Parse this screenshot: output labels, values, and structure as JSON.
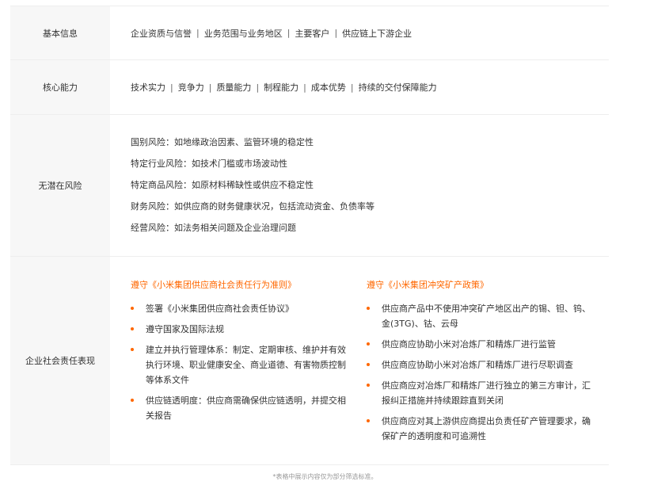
{
  "rows": [
    {
      "label": "基本信息",
      "items": [
        "企业资质与信誉",
        "业务范围与业务地区",
        "主要客户",
        "供应链上下游企业"
      ]
    },
    {
      "label": "核心能力",
      "items": [
        "技术实力",
        "竞争力",
        "质量能力",
        "制程能力",
        "成本优势",
        "持续的交付保障能力"
      ]
    },
    {
      "label": "无潜在风险",
      "lines": [
        "国别风险：如地缘政治因素、监管环境的稳定性",
        "特定行业风险：如技术门槛或市场波动性",
        "特定商品风险：如原材料稀缺性或供应不稳定性",
        "财务风险：如供应商的财务健康状况，包括流动资金、负债率等",
        "经营风险：如法务相关问题及企业治理问题"
      ]
    },
    {
      "label": "企业社会责任表现",
      "columns": [
        {
          "title": "遵守《小米集团供应商社会责任行为准则》",
          "bullets": [
            "签署《小米集团供应商社会责任协议》",
            "遵守国家及国际法规",
            "建立并执行管理体系：制定、定期审核、维护并有效执行环境、职业健康安全、商业道德、有害物质控制等体系文件",
            "供应链透明度：供应商需确保供应链透明，并提交相关报告"
          ]
        },
        {
          "title": "遵守《小米集团冲突矿产政策》",
          "bullets": [
            "供应商产品中不使用冲突矿产地区出产的锡、钽、钨、金(3TG)、钴、云母",
            "供应商应协助小米对冶炼厂和精炼厂进行监管",
            "供应商应协助小米对冶炼厂和精炼厂进行尽职调查",
            "供应商应对冶炼厂和精炼厂进行独立的第三方审计，汇报纠正措施并持续跟踪直到关闭",
            "供应商应对其上游供应商提出负责任矿产管理要求，确保矿产的透明度和可追溯性"
          ]
        }
      ]
    }
  ],
  "footnote": "*表格中展示内容仅为部分筛选标准。",
  "colors": {
    "accent": "#ff6700",
    "label_bg": "#f7f7f7",
    "border": "#eeeeee"
  }
}
